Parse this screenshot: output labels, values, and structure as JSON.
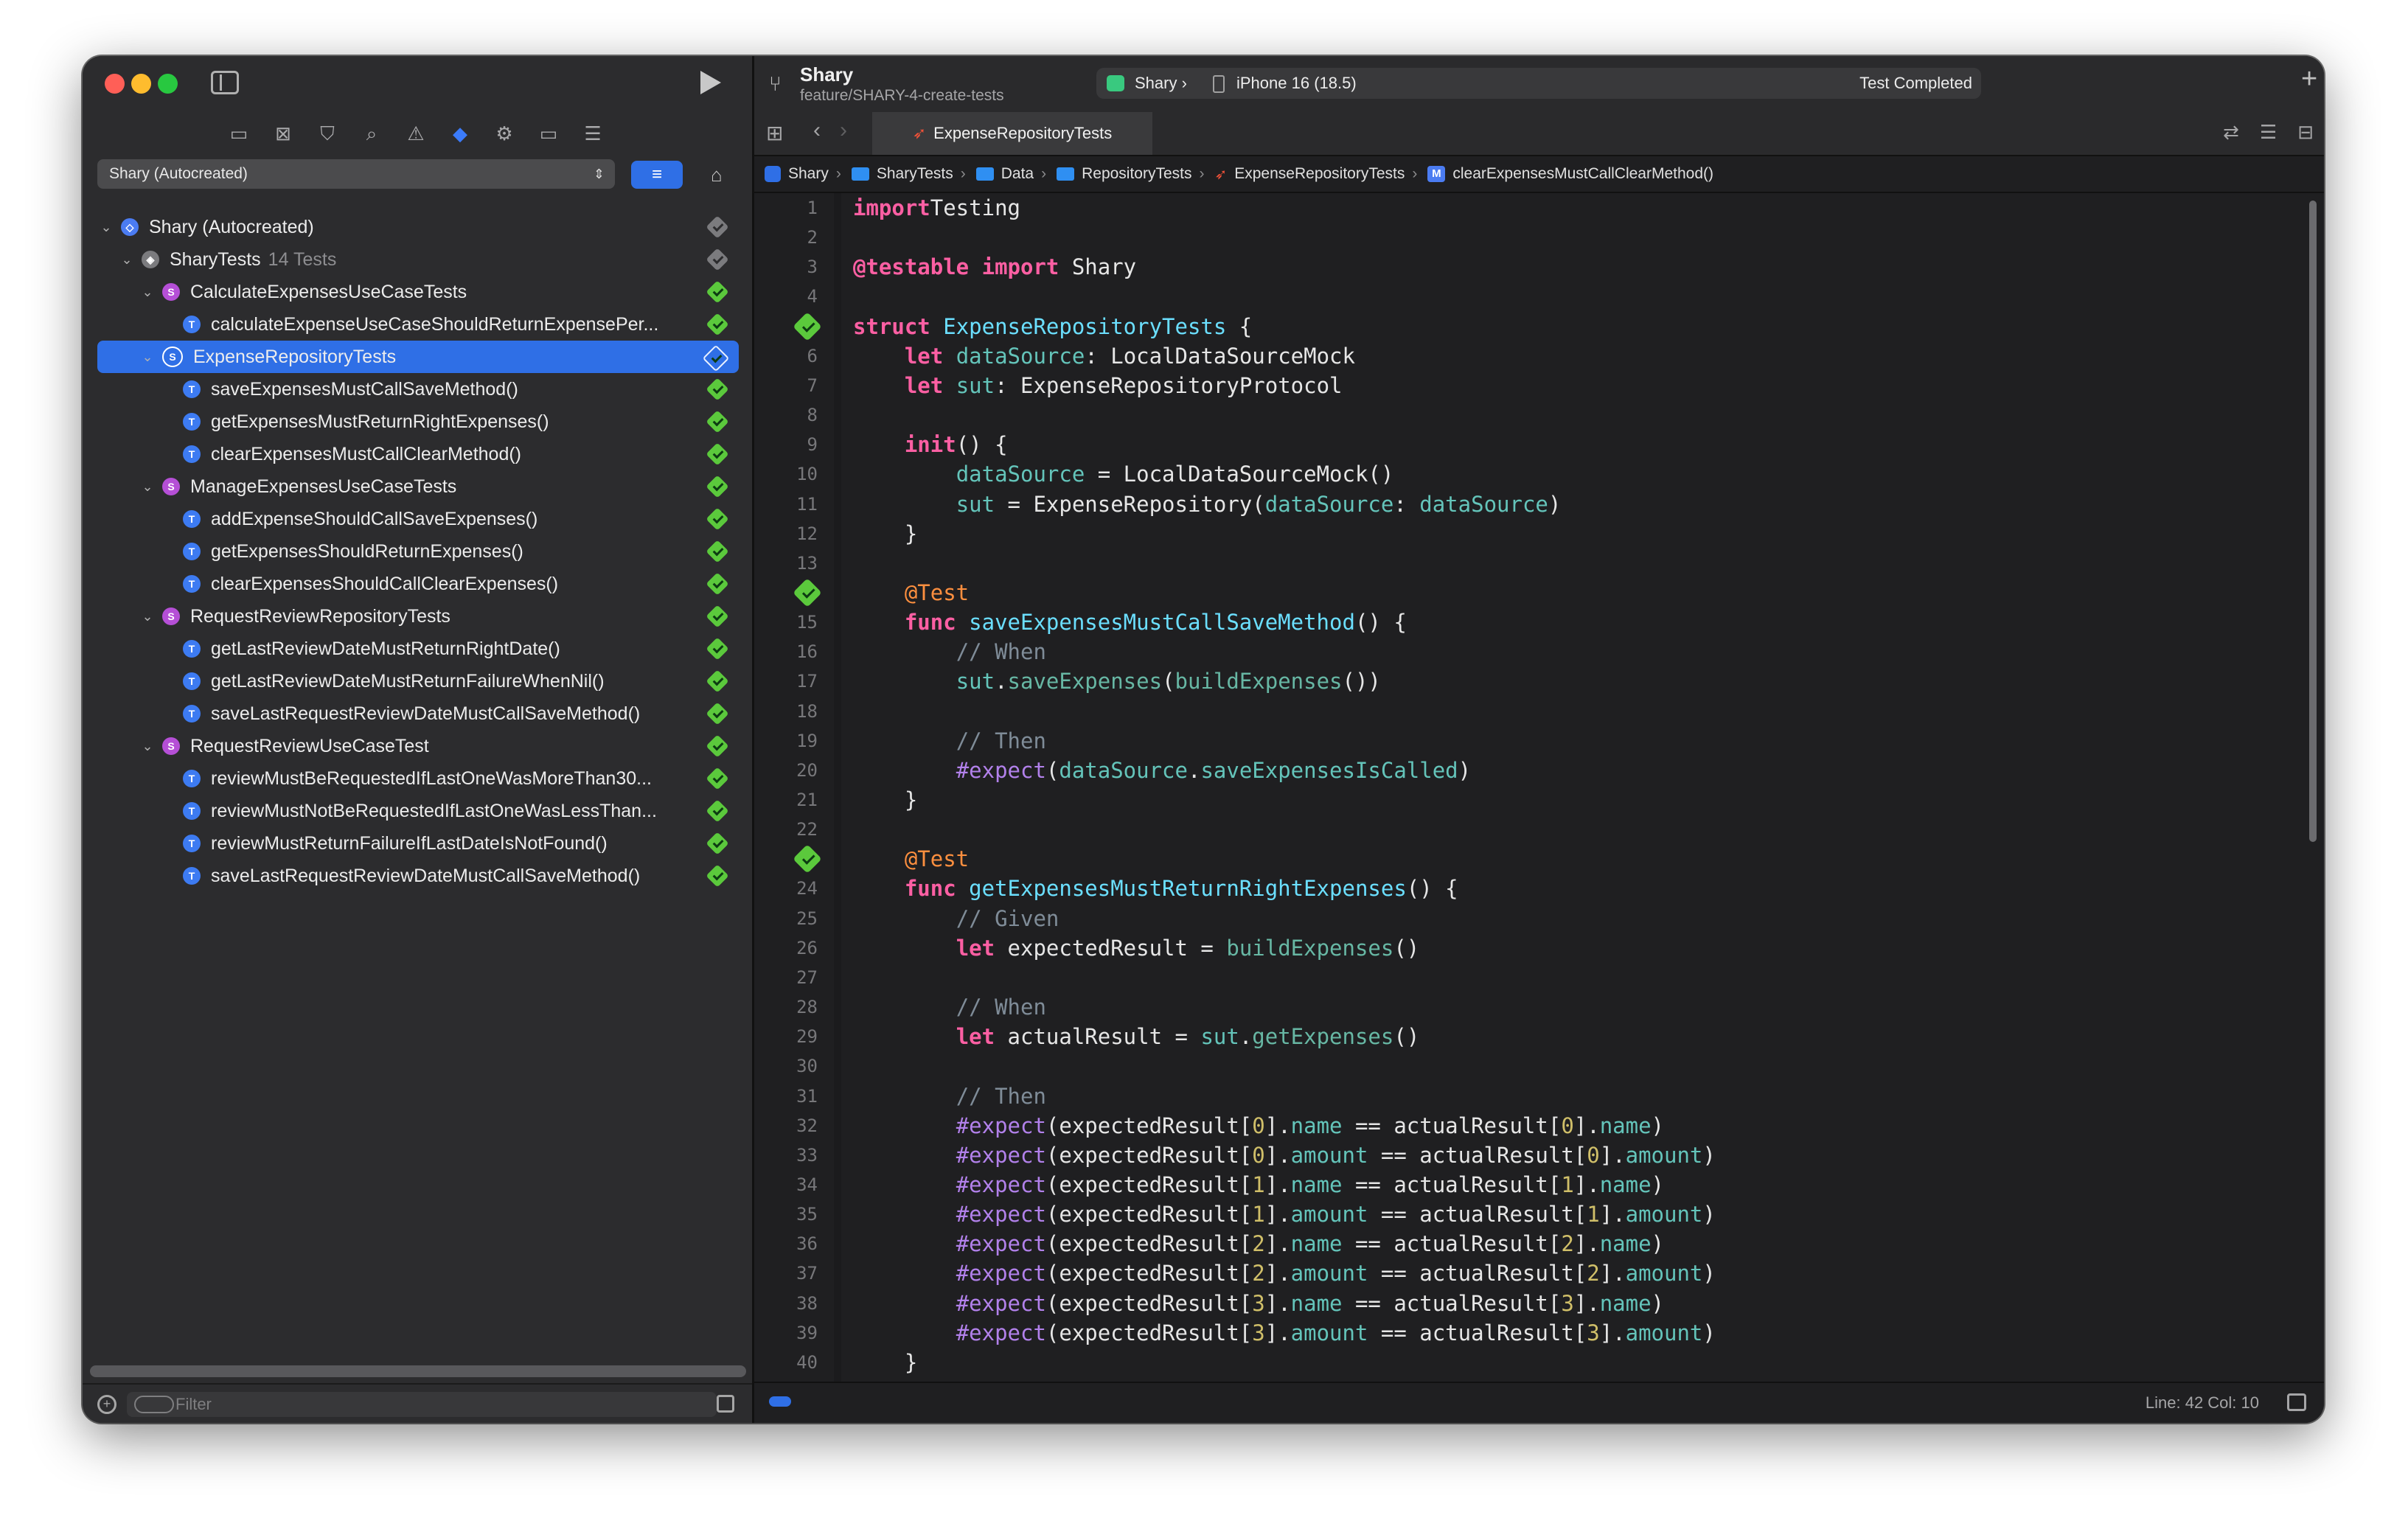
{
  "scheme_selector": {
    "label": "Shary (Autocreated)"
  },
  "test_tree": [
    {
      "label": "Shary (Autocreated)",
      "count": "",
      "level": 0,
      "kind": "plan",
      "disclosure": "open",
      "status": "gray",
      "selected": false
    },
    {
      "label": "SharyTests",
      "count": "14 Tests",
      "level": 1,
      "kind": "target",
      "disclosure": "open",
      "status": "gray",
      "selected": false
    },
    {
      "label": "CalculateExpensesUseCaseTests",
      "count": "",
      "level": 2,
      "kind": "suite",
      "disclosure": "open",
      "status": "pass",
      "selected": false
    },
    {
      "label": "calculateExpenseUseCaseShouldReturnExpensePer...",
      "count": "",
      "level": 3,
      "kind": "test",
      "disclosure": "",
      "status": "pass",
      "selected": false
    },
    {
      "label": "ExpenseRepositoryTests",
      "count": "",
      "level": 2,
      "kind": "suite",
      "disclosure": "open",
      "status": "pass",
      "selected": true
    },
    {
      "label": "saveExpensesMustCallSaveMethod()",
      "count": "",
      "level": 3,
      "kind": "test",
      "disclosure": "",
      "status": "pass",
      "selected": false
    },
    {
      "label": "getExpensesMustReturnRightExpenses()",
      "count": "",
      "level": 3,
      "kind": "test",
      "disclosure": "",
      "status": "pass",
      "selected": false
    },
    {
      "label": "clearExpensesMustCallClearMethod()",
      "count": "",
      "level": 3,
      "kind": "test",
      "disclosure": "",
      "status": "pass",
      "selected": false
    },
    {
      "label": "ManageExpensesUseCaseTests",
      "count": "",
      "level": 2,
      "kind": "suite",
      "disclosure": "open",
      "status": "pass",
      "selected": false
    },
    {
      "label": "addExpenseShouldCallSaveExpenses()",
      "count": "",
      "level": 3,
      "kind": "test",
      "disclosure": "",
      "status": "pass",
      "selected": false
    },
    {
      "label": "getExpensesShouldReturnExpenses()",
      "count": "",
      "level": 3,
      "kind": "test",
      "disclosure": "",
      "status": "pass",
      "selected": false
    },
    {
      "label": "clearExpensesShouldCallClearExpenses()",
      "count": "",
      "level": 3,
      "kind": "test",
      "disclosure": "",
      "status": "pass",
      "selected": false
    },
    {
      "label": "RequestReviewRepositoryTests",
      "count": "",
      "level": 2,
      "kind": "suite",
      "disclosure": "open",
      "status": "pass",
      "selected": false
    },
    {
      "label": "getLastReviewDateMustReturnRightDate()",
      "count": "",
      "level": 3,
      "kind": "test",
      "disclosure": "",
      "status": "pass",
      "selected": false
    },
    {
      "label": "getLastReviewDateMustReturnFailureWhenNil()",
      "count": "",
      "level": 3,
      "kind": "test",
      "disclosure": "",
      "status": "pass",
      "selected": false
    },
    {
      "label": "saveLastRequestReviewDateMustCallSaveMethod()",
      "count": "",
      "level": 3,
      "kind": "test",
      "disclosure": "",
      "status": "pass",
      "selected": false
    },
    {
      "label": "RequestReviewUseCaseTest",
      "count": "",
      "level": 2,
      "kind": "suite",
      "disclosure": "open",
      "status": "pass",
      "selected": false
    },
    {
      "label": "reviewMustBeRequestedIfLastOneWasMoreThan30...",
      "count": "",
      "level": 3,
      "kind": "test",
      "disclosure": "",
      "status": "pass",
      "selected": false
    },
    {
      "label": "reviewMustNotBeRequestedIfLastOneWasLessThan...",
      "count": "",
      "level": 3,
      "kind": "test",
      "disclosure": "",
      "status": "pass",
      "selected": false
    },
    {
      "label": "reviewMustReturnFailureIfLastDateIsNotFound()",
      "count": "",
      "level": 3,
      "kind": "test",
      "disclosure": "",
      "status": "pass",
      "selected": false
    },
    {
      "label": "saveLastRequestReviewDateMustCallSaveMethod()",
      "count": "",
      "level": 3,
      "kind": "test",
      "disclosure": "",
      "status": "pass",
      "selected": false
    }
  ],
  "filter": {
    "placeholder": "Filter"
  },
  "toolbar": {
    "project": "Shary",
    "branch": "feature/SHARY-4-create-tests",
    "scheme": "Shary",
    "device": "iPhone 16 (18.5)",
    "status": "Test Completed"
  },
  "tab": {
    "label": "ExpenseRepositoryTests"
  },
  "breadcrumb": [
    {
      "label": "Shary",
      "icon": "app"
    },
    {
      "label": "SharyTests",
      "icon": "folder"
    },
    {
      "label": "Data",
      "icon": "folder"
    },
    {
      "label": "RepositoryTests",
      "icon": "folder"
    },
    {
      "label": "ExpenseRepositoryTests",
      "icon": "swift"
    },
    {
      "label": "clearExpensesMustCallClearMethod()",
      "icon": "method"
    }
  ],
  "code_lines": [
    [
      [
        "kw",
        "import"
      ],
      [
        "",
        "Testing"
      ]
    ],
    [],
    [
      [
        "kw",
        "@testable"
      ],
      [
        "",
        " "
      ],
      [
        "kw",
        "import"
      ],
      [
        "",
        " Shary"
      ]
    ],
    [],
    [
      [
        "kw",
        "struct"
      ],
      [
        "",
        " "
      ],
      [
        "ty",
        "ExpenseRepositoryTests"
      ],
      [
        "",
        " {"
      ]
    ],
    [
      [
        "",
        "    "
      ],
      [
        "kw",
        "let"
      ],
      [
        "",
        " "
      ],
      [
        "pr",
        "dataSource"
      ],
      [
        "",
        ": LocalDataSourceMock"
      ]
    ],
    [
      [
        "",
        "    "
      ],
      [
        "kw",
        "let"
      ],
      [
        "",
        " "
      ],
      [
        "pr",
        "sut"
      ],
      [
        "",
        ": ExpenseRepositoryProtocol"
      ]
    ],
    [],
    [
      [
        "",
        "    "
      ],
      [
        "kw",
        "init"
      ],
      [
        "",
        "() {"
      ]
    ],
    [
      [
        "",
        "        "
      ],
      [
        "pr",
        "dataSource"
      ],
      [
        "",
        " = LocalDataSourceMock()"
      ]
    ],
    [
      [
        "",
        "        "
      ],
      [
        "pr",
        "sut"
      ],
      [
        "",
        " = ExpenseRepository("
      ],
      [
        "pr",
        "dataSource"
      ],
      [
        "",
        ": "
      ],
      [
        "pr",
        "dataSource"
      ],
      [
        "",
        ")"
      ]
    ],
    [
      [
        "",
        "    }"
      ]
    ],
    [],
    [
      [
        "",
        "    "
      ],
      [
        "at",
        "@Test"
      ]
    ],
    [
      [
        "",
        "    "
      ],
      [
        "kw",
        "func"
      ],
      [
        "",
        " "
      ],
      [
        "ty",
        "saveExpensesMustCallSaveMethod"
      ],
      [
        "",
        "() {"
      ]
    ],
    [
      [
        "",
        "        "
      ],
      [
        "cm",
        "// When"
      ]
    ],
    [
      [
        "",
        "        "
      ],
      [
        "pr",
        "sut"
      ],
      [
        "",
        "."
      ],
      [
        "mt",
        "saveExpenses"
      ],
      [
        "",
        "("
      ],
      [
        "mt",
        "buildExpenses"
      ],
      [
        "",
        "())"
      ]
    ],
    [],
    [
      [
        "",
        "        "
      ],
      [
        "cm",
        "// Then"
      ]
    ],
    [
      [
        "",
        "        "
      ],
      [
        "ma",
        "#expect"
      ],
      [
        "",
        "("
      ],
      [
        "pr",
        "dataSource"
      ],
      [
        "",
        "."
      ],
      [
        "pr",
        "saveExpensesIsCalled"
      ],
      [
        "",
        ")"
      ]
    ],
    [
      [
        "",
        "    }"
      ]
    ],
    [],
    [
      [
        "",
        "    "
      ],
      [
        "at",
        "@Test"
      ]
    ],
    [
      [
        "",
        "    "
      ],
      [
        "kw",
        "func"
      ],
      [
        "",
        " "
      ],
      [
        "ty",
        "getExpensesMustReturnRightExpenses"
      ],
      [
        "",
        "() {"
      ]
    ],
    [
      [
        "",
        "        "
      ],
      [
        "cm",
        "// Given"
      ]
    ],
    [
      [
        "",
        "        "
      ],
      [
        "kw",
        "let"
      ],
      [
        "",
        " expectedResult = "
      ],
      [
        "mt",
        "buildExpenses"
      ],
      [
        "",
        "()"
      ]
    ],
    [],
    [
      [
        "",
        "        "
      ],
      [
        "cm",
        "// When"
      ]
    ],
    [
      [
        "",
        "        "
      ],
      [
        "kw",
        "let"
      ],
      [
        "",
        " actualResult = "
      ],
      [
        "pr",
        "sut"
      ],
      [
        "",
        "."
      ],
      [
        "mt",
        "getExpenses"
      ],
      [
        "",
        "()"
      ]
    ],
    [],
    [
      [
        "",
        "        "
      ],
      [
        "cm",
        "// Then"
      ]
    ],
    [
      [
        "",
        "        "
      ],
      [
        "ma",
        "#expect"
      ],
      [
        "",
        "(expectedResult["
      ],
      [
        "nm",
        "0"
      ],
      [
        "",
        "]."
      ],
      [
        "pr",
        "name"
      ],
      [
        "",
        " == actualResult["
      ],
      [
        "nm",
        "0"
      ],
      [
        "",
        "]."
      ],
      [
        "pr",
        "name"
      ],
      [
        "",
        ")"
      ]
    ],
    [
      [
        "",
        "        "
      ],
      [
        "ma",
        "#expect"
      ],
      [
        "",
        "(expectedResult["
      ],
      [
        "nm",
        "0"
      ],
      [
        "",
        "]."
      ],
      [
        "pr",
        "amount"
      ],
      [
        "",
        " == actualResult["
      ],
      [
        "nm",
        "0"
      ],
      [
        "",
        "]."
      ],
      [
        "pr",
        "amount"
      ],
      [
        "",
        ")"
      ]
    ],
    [
      [
        "",
        "        "
      ],
      [
        "ma",
        "#expect"
      ],
      [
        "",
        "(expectedResult["
      ],
      [
        "nm",
        "1"
      ],
      [
        "",
        "]."
      ],
      [
        "pr",
        "name"
      ],
      [
        "",
        " == actualResult["
      ],
      [
        "nm",
        "1"
      ],
      [
        "",
        "]."
      ],
      [
        "pr",
        "name"
      ],
      [
        "",
        ")"
      ]
    ],
    [
      [
        "",
        "        "
      ],
      [
        "ma",
        "#expect"
      ],
      [
        "",
        "(expectedResult["
      ],
      [
        "nm",
        "1"
      ],
      [
        "",
        "]."
      ],
      [
        "pr",
        "amount"
      ],
      [
        "",
        " == actualResult["
      ],
      [
        "nm",
        "1"
      ],
      [
        "",
        "]."
      ],
      [
        "pr",
        "amount"
      ],
      [
        "",
        ")"
      ]
    ],
    [
      [
        "",
        "        "
      ],
      [
        "ma",
        "#expect"
      ],
      [
        "",
        "(expectedResult["
      ],
      [
        "nm",
        "2"
      ],
      [
        "",
        "]."
      ],
      [
        "pr",
        "name"
      ],
      [
        "",
        " == actualResult["
      ],
      [
        "nm",
        "2"
      ],
      [
        "",
        "]."
      ],
      [
        "pr",
        "name"
      ],
      [
        "",
        ")"
      ]
    ],
    [
      [
        "",
        "        "
      ],
      [
        "ma",
        "#expect"
      ],
      [
        "",
        "(expectedResult["
      ],
      [
        "nm",
        "2"
      ],
      [
        "",
        "]."
      ],
      [
        "pr",
        "amount"
      ],
      [
        "",
        " == actualResult["
      ],
      [
        "nm",
        "2"
      ],
      [
        "",
        "]."
      ],
      [
        "pr",
        "amount"
      ],
      [
        "",
        ")"
      ]
    ],
    [
      [
        "",
        "        "
      ],
      [
        "ma",
        "#expect"
      ],
      [
        "",
        "(expectedResult["
      ],
      [
        "nm",
        "3"
      ],
      [
        "",
        "]."
      ],
      [
        "pr",
        "name"
      ],
      [
        "",
        " == actualResult["
      ],
      [
        "nm",
        "3"
      ],
      [
        "",
        "]."
      ],
      [
        "pr",
        "name"
      ],
      [
        "",
        ")"
      ]
    ],
    [
      [
        "",
        "        "
      ],
      [
        "ma",
        "#expect"
      ],
      [
        "",
        "(expectedResult["
      ],
      [
        "nm",
        "3"
      ],
      [
        "",
        "]."
      ],
      [
        "pr",
        "amount"
      ],
      [
        "",
        " == actualResult["
      ],
      [
        "nm",
        "3"
      ],
      [
        "",
        "]."
      ],
      [
        "pr",
        "amount"
      ],
      [
        "",
        ")"
      ]
    ],
    [
      [
        "",
        "    }"
      ]
    ]
  ],
  "gutter_pass_lines": [
    5,
    14,
    23
  ],
  "status_bar": {
    "position": "Line: 42  Col: 10"
  },
  "colors": {
    "accent": "#2f6fe6",
    "pass": "#5bc93c",
    "keyword": "#fc5fa3",
    "type": "#6bdfff",
    "comment": "#7f8c98",
    "macro": "#b281eb",
    "attribute": "#fd8f3f"
  }
}
